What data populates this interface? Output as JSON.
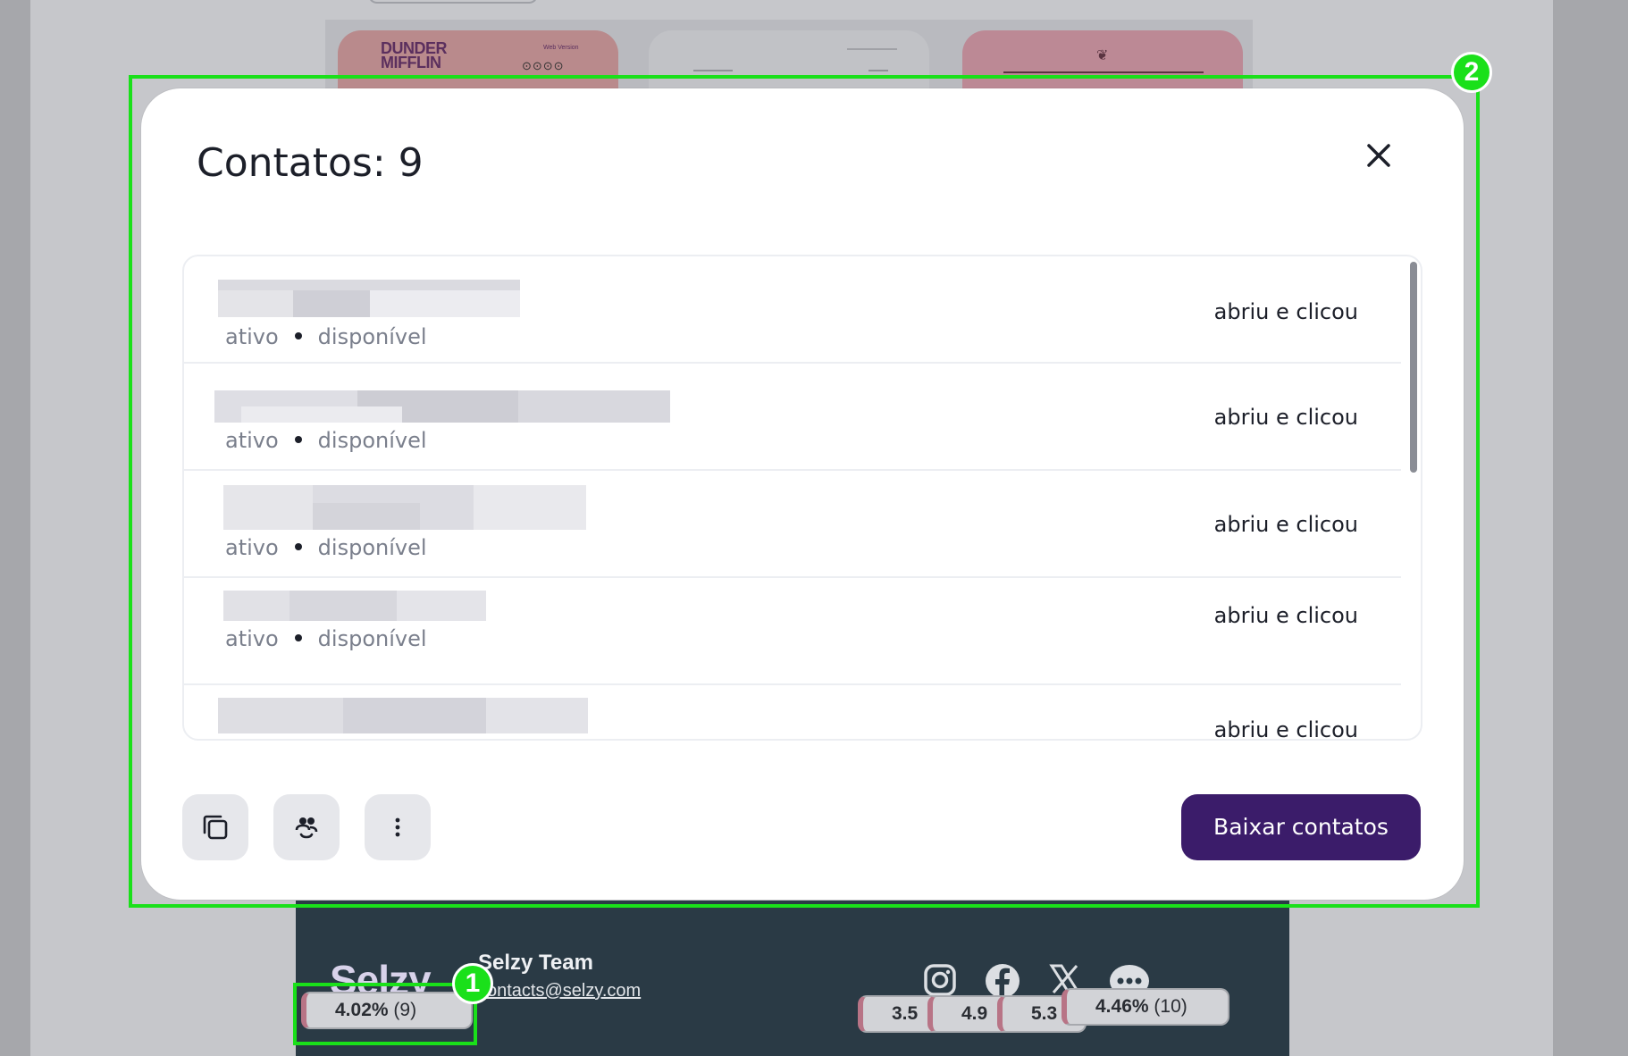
{
  "background": {
    "header_card": {
      "logo_lines": [
        "DUNDER",
        "MIFFLIN"
      ],
      "web_version": "Web Version",
      "social_dots": "⊙⊙⊙⊙"
    },
    "footer": {
      "logo": "Selzy",
      "team_name": "Selzy Team",
      "email": "contacts@selzy.com",
      "social_icons": [
        "instagram-icon",
        "facebook-icon",
        "x-icon",
        "chat-icon"
      ]
    },
    "pills": [
      {
        "percent": "4.02%",
        "count": "(9)"
      },
      {
        "percent": "3.5",
        "count": ""
      },
      {
        "percent": "4.9",
        "count": ""
      },
      {
        "percent": "5.3",
        "count": ""
      },
      {
        "percent": "4.46%",
        "count": "(10)"
      }
    ]
  },
  "annotations": {
    "marker_1": "1",
    "marker_2": "2",
    "color": "#1ae01a"
  },
  "modal": {
    "title": "Contatos: 9",
    "close_icon": "close-icon",
    "rows": [
      {
        "status": "ativo",
        "availability": "disponível",
        "action": "abriu e clicou"
      },
      {
        "status": "ativo",
        "availability": "disponível",
        "action": "abriu e clicou"
      },
      {
        "status": "ativo",
        "availability": "disponível",
        "action": "abriu e clicou"
      },
      {
        "status": "ativo",
        "availability": "disponível",
        "action": "abriu e clicou"
      },
      {
        "status": "",
        "availability": "",
        "action": "abriu e clicou"
      }
    ],
    "toolbar": {
      "copy_icon": "copy-icon",
      "segment_icon": "group-icon",
      "more_icon": "more-vertical-icon",
      "download_label": "Baixar contatos"
    },
    "colors": {
      "primary": "#3b1c6a",
      "text": "#1c1f29",
      "muted": "#7a7f8c"
    }
  }
}
